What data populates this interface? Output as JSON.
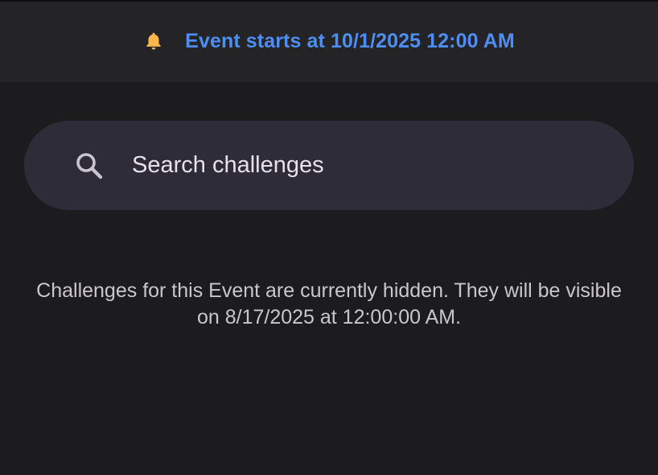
{
  "banner": {
    "icon": "bell-icon",
    "icon_color": "#ffb74d",
    "text": "Event starts at 10/1/2025 12:00 AM",
    "text_color": "#4e8ef3"
  },
  "search": {
    "icon": "search-icon",
    "placeholder": "Search challenges",
    "value": ""
  },
  "message": {
    "text": "Challenges for this Event are currently hidden. They will be visible on 8/17/2025 at 12:00:00 AM."
  },
  "colors": {
    "background": "#1c1c1e",
    "banner_background": "#242427",
    "search_background": "#2f2c3a"
  }
}
